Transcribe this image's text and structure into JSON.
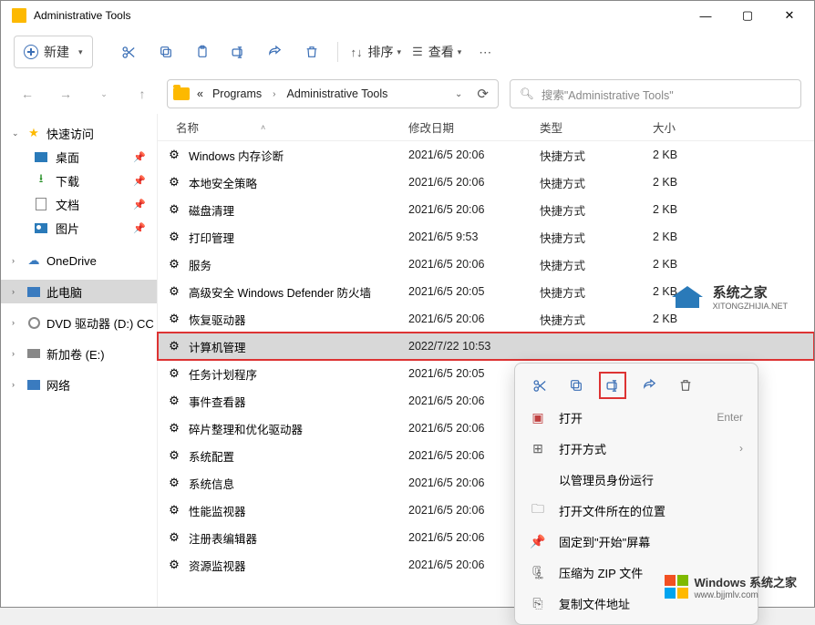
{
  "title": "Administrative Tools",
  "toolbar": {
    "new": "新建",
    "sort": "排序",
    "view": "查看"
  },
  "breadcrumb": {
    "sep0": "«",
    "item1": "Programs",
    "item2": "Administrative Tools"
  },
  "search_placeholder": "搜索\"Administrative Tools\"",
  "sidebar": {
    "quick": "快速访问",
    "desktop": "桌面",
    "downloads": "下载",
    "documents": "文档",
    "pictures": "图片",
    "onedrive": "OneDrive",
    "thispc": "此电脑",
    "dvd": "DVD 驱动器 (D:) CC",
    "newvol": "新加卷 (E:)",
    "network": "网络"
  },
  "columns": {
    "name": "名称",
    "date": "修改日期",
    "type": "类型",
    "size": "大小"
  },
  "type_shortcut": "快捷方式",
  "rows": [
    {
      "name": "Windows 内存诊断",
      "date": "2021/6/5 20:06",
      "size": "2 KB"
    },
    {
      "name": "本地安全策略",
      "date": "2021/6/5 20:06",
      "size": "2 KB"
    },
    {
      "name": "磁盘清理",
      "date": "2021/6/5 20:06",
      "size": "2 KB"
    },
    {
      "name": "打印管理",
      "date": "2021/6/5 9:53",
      "size": "2 KB"
    },
    {
      "name": "服务",
      "date": "2021/6/5 20:06",
      "size": "2 KB"
    },
    {
      "name": "高级安全 Windows Defender 防火墙",
      "date": "2021/6/5 20:05",
      "size": "2 KB"
    },
    {
      "name": "恢复驱动器",
      "date": "2021/6/5 20:06",
      "size": "2 KB"
    },
    {
      "name": "计算机管理",
      "date": "2022/7/22 10:53",
      "size": ""
    },
    {
      "name": "任务计划程序",
      "date": "2021/6/5 20:05",
      "size": ""
    },
    {
      "name": "事件查看器",
      "date": "2021/6/5 20:06",
      "size": ""
    },
    {
      "name": "碎片整理和优化驱动器",
      "date": "2021/6/5 20:06",
      "size": ""
    },
    {
      "name": "系统配置",
      "date": "2021/6/5 20:06",
      "size": ""
    },
    {
      "name": "系统信息",
      "date": "2021/6/5 20:06",
      "size": ""
    },
    {
      "name": "性能监视器",
      "date": "2021/6/5 20:06",
      "size": ""
    },
    {
      "name": "注册表编辑器",
      "date": "2021/6/5 20:06",
      "size": ""
    },
    {
      "name": "资源监视器",
      "date": "2021/6/5 20:06",
      "size": ""
    }
  ],
  "highlight_index": 7,
  "context_menu": {
    "open": "打开",
    "open_acc": "Enter",
    "open_with": "打开方式",
    "run_admin": "以管理员身份运行",
    "open_location": "打开文件所在的位置",
    "pin_start": "固定到\"开始\"屏幕",
    "compress_zip": "压缩为 ZIP 文件",
    "copy_path": "复制文件地址"
  },
  "watermark1": {
    "brand": "系统之家",
    "url": "XITONGZHIJIA.NET"
  },
  "watermark2": {
    "brand": "Windows 系统之家",
    "url": "www.bjjmlv.com"
  }
}
